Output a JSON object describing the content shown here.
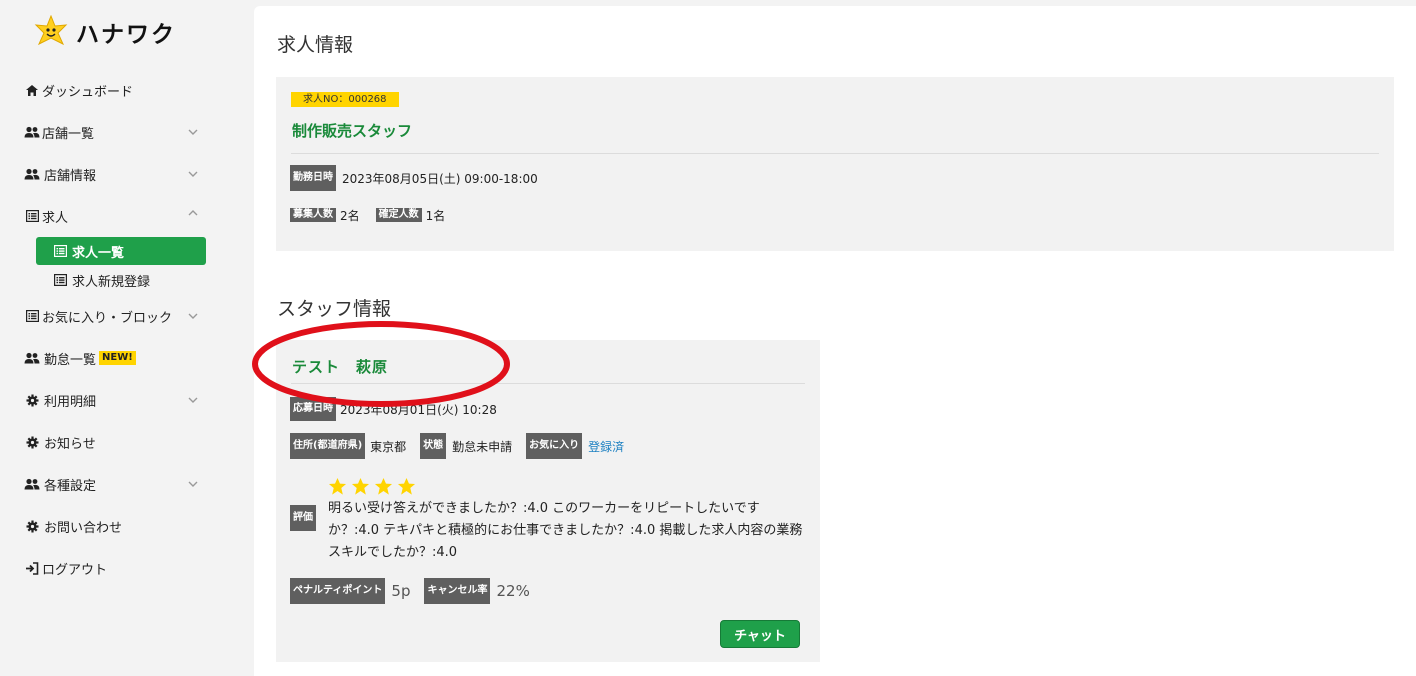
{
  "brand": {
    "name": "ハナワク"
  },
  "sidebar": {
    "items": [
      {
        "label": "ダッシュボード",
        "icon": "home-icon",
        "chevron": ""
      },
      {
        "label": "店舗一覧",
        "icon": "users-icon",
        "chevron": "down"
      },
      {
        "label": "店舗情報",
        "icon": "users-icon",
        "chevron": "down"
      },
      {
        "label": "求人",
        "icon": "list-icon",
        "chevron": "up"
      },
      {
        "label": "お気に入り・ブロック",
        "icon": "list-icon",
        "chevron": "down"
      },
      {
        "label": "勤怠一覧",
        "icon": "users-icon",
        "badge": "NEW!",
        "chevron": ""
      },
      {
        "label": "利用明細",
        "icon": "gear-icon",
        "chevron": "down"
      },
      {
        "label": "お知らせ",
        "icon": "gear-icon",
        "chevron": ""
      },
      {
        "label": "各種設定",
        "icon": "users-icon",
        "chevron": "down"
      },
      {
        "label": "お問い合わせ",
        "icon": "gear-icon",
        "chevron": ""
      },
      {
        "label": "ログアウト",
        "icon": "logout-icon",
        "chevron": ""
      }
    ],
    "sub_items": [
      {
        "label": "求人一覧",
        "active": true
      },
      {
        "label": "求人新規登録",
        "active": false
      }
    ]
  },
  "job_section": {
    "title": "求人情報",
    "job_no": "求人NO：000268",
    "job_title": "制作販売スタッフ",
    "work_date_tag": "勤務日時",
    "work_date": "2023年08月05日(土) 09:00-18:00",
    "recruit_tag": "募集人数",
    "recruit_count": "2名",
    "confirmed_tag": "確定人数",
    "confirmed_count": "1名"
  },
  "staff_section": {
    "title": "スタッフ情報",
    "name": "テスト　萩原",
    "apply_tag": "応募日時",
    "apply_date": "2023年08月01日(火) 10:28",
    "address_tag": "住所(都道府県)",
    "address": "東京都",
    "status_tag": "状態",
    "status": "勤怠未申請",
    "favorite_tag": "お気に入り",
    "favorite": "登録済",
    "rating_tag": "評価",
    "rating_stars": 4,
    "review": "明るい受け答えができましたか？:4.0  このワーカーをリピートしたいですか？:4.0  テキパキと積極的にお仕事できましたか？:4.0  掲載した求人内容の業務スキルでしたか？:4.0",
    "penalty_tag": "ペナルティポイント",
    "penalty": "5p",
    "cancel_tag": "キャンセル率",
    "cancel_rate": "22%",
    "chat_button": "チャット"
  },
  "colors": {
    "accent_green": "#1fa04a",
    "title_green": "#1a8a3a",
    "badge_yellow": "#ffd400",
    "annotation_red": "#e0101a",
    "link_blue": "#1a7fc1"
  }
}
